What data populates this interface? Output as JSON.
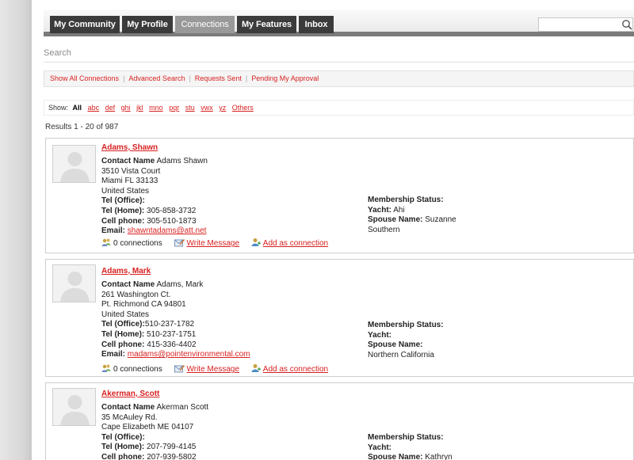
{
  "nav": {
    "tabs": [
      {
        "label": "My Community",
        "active": false
      },
      {
        "label": "My Profile",
        "active": false
      },
      {
        "label": "Connections",
        "active": true
      },
      {
        "label": "My Features",
        "active": false
      },
      {
        "label": "Inbox",
        "active": false
      }
    ],
    "search_value": ""
  },
  "search": {
    "label": "Search"
  },
  "actionbar": {
    "links": [
      "Show All Connections",
      "Advanced Search",
      "Requests Sent",
      "Pending My Approval"
    ]
  },
  "showbar": {
    "label": "Show:",
    "letters": [
      "All",
      "abc",
      "def",
      "ghi",
      "jkl",
      "mno",
      "pqr",
      "stu",
      "vwx",
      "yz",
      "Others"
    ],
    "active": "All"
  },
  "results": {
    "text": "Results 1 - 20 of 987"
  },
  "contacts": [
    {
      "name": "Adams, Shawn",
      "contact_name_label": "Contact Name",
      "contact_name": "Adams Shawn",
      "address1": "3510 Vista Court",
      "city_line": "Miami FL 33133",
      "country": "United States",
      "tel_office_label": "Tel (Office):",
      "tel_office": "",
      "tel_home_label": "Tel (Home):",
      "tel_home": "305-858-3732",
      "cell_label": "Cell phone:",
      "cell": "305-510-1873",
      "email_label": "Email:",
      "email": "shawntadams@att.net",
      "membership_label": "Membership Status:",
      "membership": "",
      "yacht_label": "Yacht:",
      "yacht": "Ahi",
      "spouse_label": "Spouse Name:",
      "spouse": "Suzanne",
      "extra": "Southern",
      "connections": "0 connections",
      "write_message": "Write Message",
      "add_connection": "Add as connection"
    },
    {
      "name": "Adams, Mark",
      "contact_name_label": "Contact Name",
      "contact_name": "Adams, Mark",
      "address1": "261 Washington Ct.",
      "city_line": "Pt. Richmond CA 94801",
      "country": "United States",
      "tel_office_label": "Tel (Office):",
      "tel_office": "510-237-1782",
      "tel_home_label": "Tel (Home):",
      "tel_home": "510-237-1751",
      "cell_label": "Cell phone:",
      "cell": "415-336-4402",
      "email_label": "Email:",
      "email": "madams@pointenvironmental.com",
      "membership_label": "Membership Status:",
      "membership": "",
      "yacht_label": "Yacht:",
      "yacht": "",
      "spouse_label": "Spouse Name:",
      "spouse": "",
      "extra": "Northern California",
      "connections": "0 connections",
      "write_message": "Write Message",
      "add_connection": "Add as connection"
    },
    {
      "name": "Akerman, Scott",
      "contact_name_label": "Contact Name",
      "contact_name": "Akerman Scott",
      "address1": "35 McAuley Rd.",
      "city_line": "Cape Elizabeth ME 04107",
      "country": "",
      "tel_office_label": "Tel (Office):",
      "tel_office": "",
      "tel_home_label": "Tel (Home):",
      "tel_home": "207-799-4145",
      "cell_label": "Cell phone:",
      "cell": "207-939-5802",
      "email_label": "",
      "email": "",
      "membership_label": "Membership Status:",
      "membership": "",
      "yacht_label": "Yacht:",
      "yacht": "",
      "spouse_label": "Spouse Name:",
      "spouse": "Kathryn",
      "extra": "",
      "connections": "",
      "write_message": "",
      "add_connection": ""
    }
  ],
  "colors": {
    "accent_red": "#d82020",
    "tab_dark": "#3b3b3b",
    "tab_active": "#999999"
  }
}
